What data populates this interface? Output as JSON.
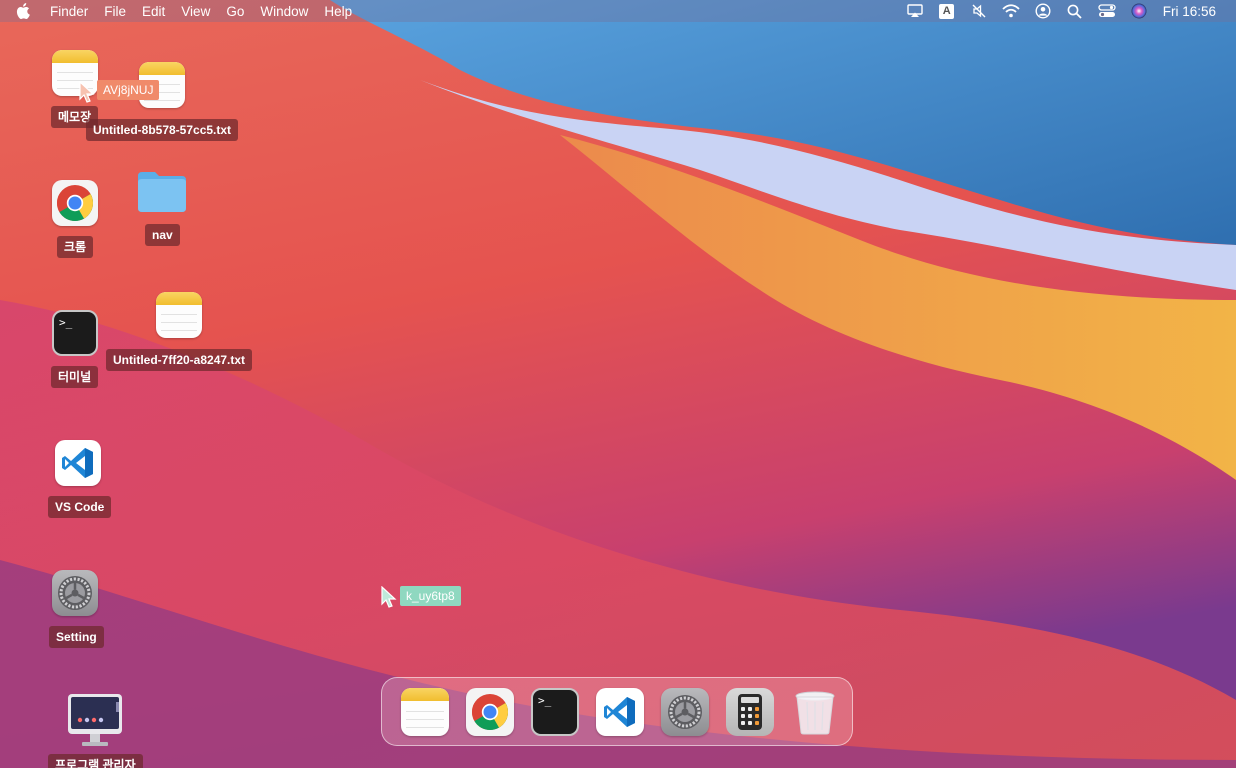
{
  "menubar": {
    "items": [
      "Finder",
      "File",
      "Edit",
      "View",
      "Go",
      "Window",
      "Help"
    ],
    "status_icons": [
      "airplay-icon",
      "input-source-icon",
      "mute-icon",
      "wifi-icon",
      "user-icon",
      "search-icon",
      "control-center-icon",
      "siri-icon"
    ],
    "input_source_letter": "A",
    "clock": "Fri 16:56"
  },
  "desktop": {
    "icons": [
      {
        "label": "메모장",
        "icon": "notes-icon"
      },
      {
        "label": "Untitled-8b578-57cc5.txt",
        "icon": "notes-icon"
      },
      {
        "label": "크롬",
        "icon": "chrome-icon"
      },
      {
        "label": "nav",
        "icon": "folder-icon"
      },
      {
        "label": "터미널",
        "icon": "terminal-icon"
      },
      {
        "label": "Untitled-7ff20-a8247.txt",
        "icon": "notes-icon"
      },
      {
        "label": "VS Code",
        "icon": "vscode-icon"
      },
      {
        "label": "Setting",
        "icon": "settings-icon"
      },
      {
        "label": "프로그램 관리자",
        "icon": "monitor-icon"
      }
    ]
  },
  "cursors": [
    {
      "name": "AVj8jNUJ",
      "color": "#f08a6a"
    },
    {
      "name": "k_uy6tp8",
      "color": "#8fd8c0"
    }
  ],
  "dock": {
    "items": [
      "notes-icon",
      "chrome-icon",
      "terminal-icon",
      "vscode-icon",
      "settings-icon",
      "calculator-icon",
      "trash-icon"
    ]
  },
  "terminal_prompt": ">_"
}
